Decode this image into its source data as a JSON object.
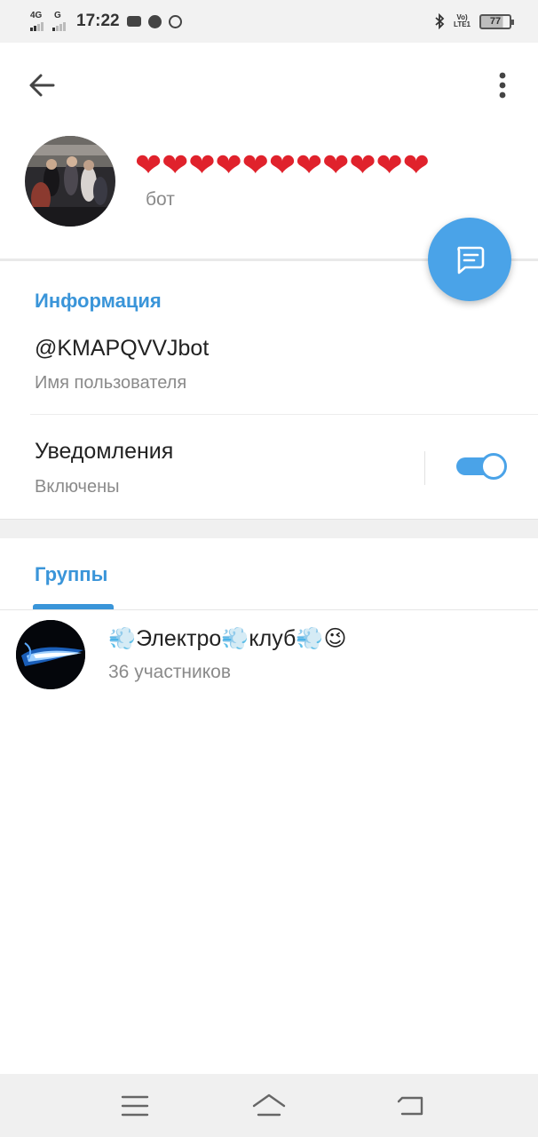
{
  "status_bar": {
    "net1": "4G",
    "net2": "G",
    "time": "17:22",
    "volte_line1": "Vo)",
    "volte_line2": "LTE1",
    "battery": "77",
    "battery_level": 0.77
  },
  "header": {
    "title_hearts": "❤❤❤❤❤❤❤❤❤❤❤",
    "subtitle": "бот",
    "icons": [
      "arrow-left-icon",
      "more-vertical-icon",
      "message-icon"
    ]
  },
  "info": {
    "section_title": "Информация",
    "username": "@KMAPQVVJbot",
    "username_label": "Имя пользователя",
    "notifications_label": "Уведомления",
    "notifications_state": "Включены",
    "notifications_on": true
  },
  "groups": {
    "section_title": "Группы",
    "items": [
      {
        "name": "Электро клуб",
        "members": "36 участников"
      }
    ]
  },
  "colors": {
    "accent": "#3a95d9",
    "fab": "#4aa3e8",
    "heart": "#e0222c"
  }
}
